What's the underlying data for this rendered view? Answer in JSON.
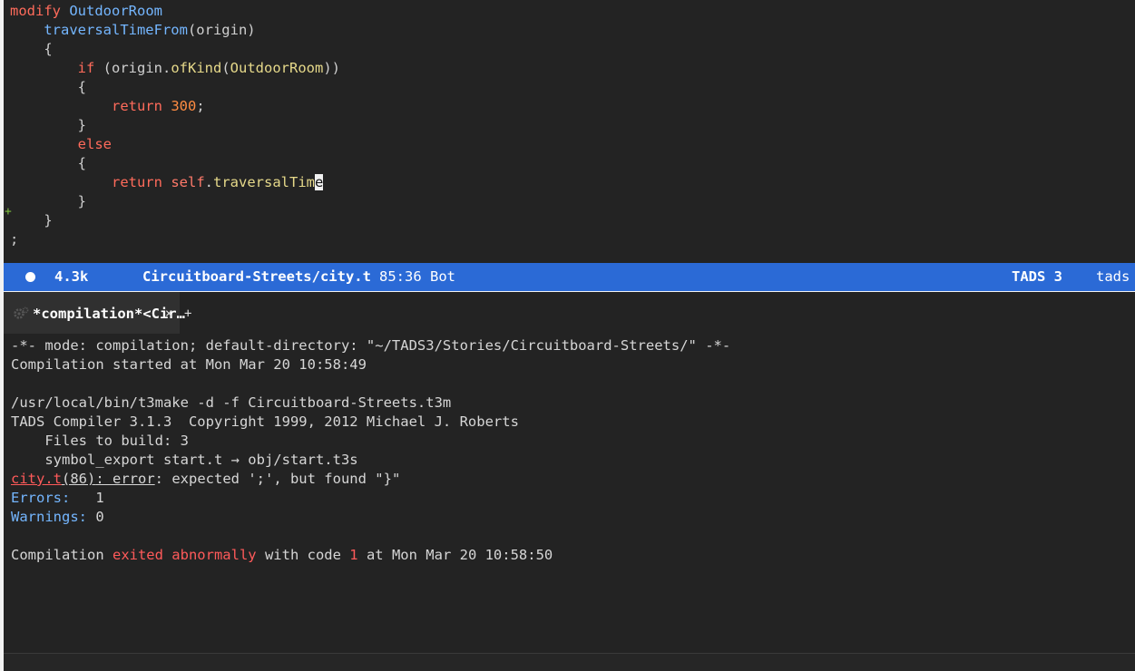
{
  "editor": {
    "lines": [
      {
        "segs": [
          {
            "t": "modify",
            "c": "kw"
          },
          {
            "t": " "
          },
          {
            "t": "OutdoorRoom",
            "c": "type"
          }
        ]
      },
      {
        "segs": [
          {
            "t": "    "
          },
          {
            "t": "traversalTimeFrom",
            "c": "fnb"
          },
          {
            "t": "(origin)"
          }
        ]
      },
      {
        "segs": [
          {
            "t": "    {"
          }
        ]
      },
      {
        "segs": [
          {
            "t": "        "
          },
          {
            "t": "if",
            "c": "kw"
          },
          {
            "t": " (origin."
          },
          {
            "t": "ofKind",
            "c": "fn"
          },
          {
            "t": "("
          },
          {
            "t": "OutdoorRoom",
            "c": "fn"
          },
          {
            "t": "))"
          }
        ]
      },
      {
        "segs": [
          {
            "t": "        {"
          }
        ]
      },
      {
        "segs": [
          {
            "t": "            "
          },
          {
            "t": "return",
            "c": "kw"
          },
          {
            "t": " "
          },
          {
            "t": "300",
            "c": "num"
          },
          {
            "t": ";"
          }
        ]
      },
      {
        "segs": [
          {
            "t": "        }"
          }
        ]
      },
      {
        "segs": [
          {
            "t": "        "
          },
          {
            "t": "else",
            "c": "kw"
          }
        ]
      },
      {
        "segs": [
          {
            "t": "        {"
          }
        ]
      },
      {
        "segs": [
          {
            "t": "            "
          },
          {
            "t": "return",
            "c": "kw"
          },
          {
            "t": " "
          },
          {
            "t": "self",
            "c": "slf"
          },
          {
            "t": "."
          },
          {
            "t": "traversalTim",
            "c": "fn"
          },
          {
            "t": "e",
            "c": "cursor"
          }
        ]
      },
      {
        "segs": [
          {
            "t": "        }"
          }
        ]
      },
      {
        "segs": [
          {
            "t": "    }"
          }
        ]
      },
      {
        "segs": [
          {
            "t": ";"
          }
        ]
      }
    ],
    "gutter_plus": "+"
  },
  "modeline": {
    "size": "4.3k",
    "file": "Circuitboard-Streets/city.t",
    "position": "85:36 Bot",
    "major_mode": "TADS 3",
    "vcs": "tads"
  },
  "compilation_tab": {
    "title": "*compilation*<Cir…",
    "close": "×",
    "add": "+"
  },
  "compilation": {
    "line1": "-*- mode: compilation; default-directory: \"~/TADS3/Stories/Circuitboard-Streets/\" -*-",
    "line2": "Compilation started at Mon Mar 20 10:58:49",
    "line4": "/usr/local/bin/t3make -d -f Circuitboard-Streets.t3m",
    "line5": "TADS Compiler 3.1.3  Copyright 1999, 2012 Michael J. Roberts",
    "line6": "    Files to build: 3",
    "line7": "    symbol_export start.t → obj/start.t3s",
    "error_file": "city.t",
    "error_line_num": "(86)",
    "error_sep": ": ",
    "error_word": "error",
    "error_msg": ": expected ';', but found \"}\"",
    "errors_label": "Errors:",
    "errors_value": "   1",
    "warnings_label": "Warnings:",
    "warnings_value": " 0",
    "exit_pre": "Compilation ",
    "exit_status": "exited abnormally",
    "exit_mid": " with code ",
    "exit_code": "1",
    "exit_post": " at Mon Mar 20 10:58:50"
  },
  "colors": {
    "modeline_bg": "#2b6ad6",
    "background": "#232323",
    "error": "#ff5a5a"
  }
}
